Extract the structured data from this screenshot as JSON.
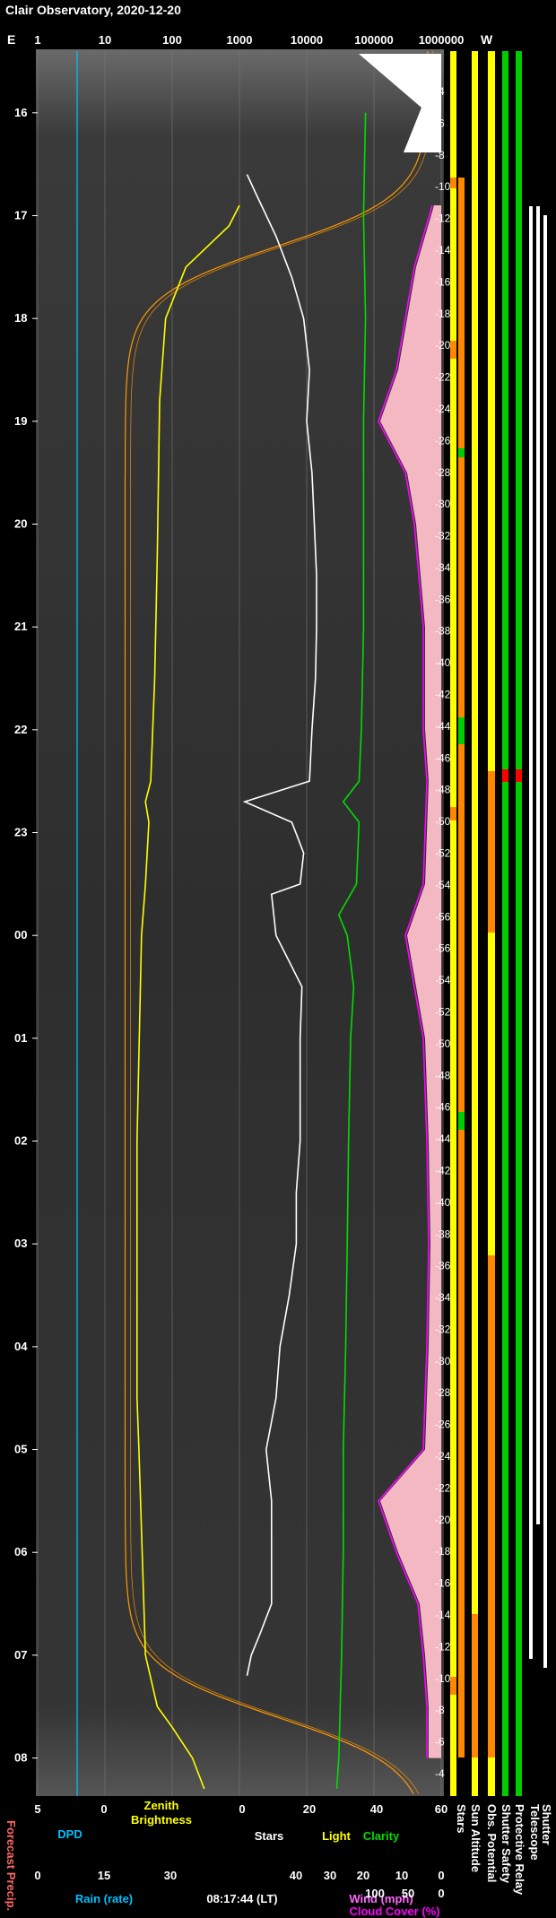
{
  "title": "Clair Observatory, 2020-12-20",
  "colors": {
    "background": "#000000",
    "zenith_brightness": "#ffff00",
    "stars": "#ffffff",
    "clarity": "#00dd00",
    "cloud_cover": "#ff00ff",
    "cloud_fill": "#ffc0cb",
    "dpd": "#00c0ff",
    "rain": "#00c0ff",
    "sun_track": "#ff9900",
    "status_green": "#00cc00",
    "status_yellow": "#ffff00",
    "status_orange": "#ff8800",
    "status_red": "#ff0000"
  },
  "chart_data": {
    "type": "line",
    "top_axis": {
      "left_label": "E",
      "right_label": "W",
      "ticks": [
        "1",
        "10",
        "100",
        "1000",
        "10000",
        "100000",
        "1000000"
      ],
      "scale": "log"
    },
    "time_axis": {
      "labels": [
        "16",
        "17",
        "18",
        "19",
        "20",
        "21",
        "22",
        "23",
        "00",
        "01",
        "02",
        "03",
        "04",
        "05",
        "06",
        "07",
        "08"
      ],
      "start_hour": 15.4,
      "end_hour": 32.37
    },
    "altitude_axis": {
      "labels": [
        "-4",
        "-6",
        "-8",
        "-10",
        "-12",
        "-14",
        "-16",
        "-18",
        "-20",
        "-22",
        "-24",
        "-26",
        "-28",
        "-30",
        "-32",
        "-34",
        "-36",
        "-38",
        "-40",
        "-42",
        "-44",
        "-46",
        "-48",
        "-50",
        "-52",
        "-54",
        "-56",
        "-56",
        "-54",
        "-52",
        "-50",
        "-48",
        "-46",
        "-44",
        "-42",
        "-40",
        "-38",
        "-36",
        "-34",
        "-32",
        "-30",
        "-28",
        "-26",
        "-24",
        "-22",
        "-20",
        "-18",
        "-16",
        "-14",
        "-12",
        "-10",
        "-8",
        "-6",
        "-4"
      ],
      "values": [
        -4,
        -6,
        -8,
        -10,
        -12,
        -14,
        -16,
        -18,
        -20,
        -22,
        -24,
        -26,
        -28,
        -30,
        -32,
        -34,
        -36,
        -38,
        -40,
        -42,
        -44,
        -46,
        -48,
        -50,
        -52,
        -54,
        -56,
        -56,
        -54,
        -52,
        -50,
        -48,
        -46,
        -44,
        -42,
        -40,
        -38,
        -36,
        -34,
        -32,
        -30,
        -28,
        -26,
        -24,
        -22,
        -20,
        -18,
        -16,
        -14,
        -12,
        -10,
        -8,
        -6,
        -4
      ]
    },
    "series": [
      {
        "name": "Zenith Brightness",
        "points": [
          [
            16.9,
            1000
          ],
          [
            17.1,
            700
          ],
          [
            17.5,
            160
          ],
          [
            18.0,
            80
          ],
          [
            18.8,
            65
          ],
          [
            20.3,
            60
          ],
          [
            21.5,
            55
          ],
          [
            22.5,
            48
          ],
          [
            22.7,
            40
          ],
          [
            22.9,
            45
          ],
          [
            23.5,
            40
          ],
          [
            24.0,
            35
          ],
          [
            26.0,
            30
          ],
          [
            28.5,
            30
          ],
          [
            29.0,
            32
          ],
          [
            31.0,
            40
          ],
          [
            31.5,
            60
          ],
          [
            31.7,
            100
          ],
          [
            32.0,
            200
          ],
          [
            32.3,
            300
          ]
        ]
      },
      {
        "name": "Stars",
        "points": [
          [
            16.6,
            1300
          ],
          [
            16.8,
            1800
          ],
          [
            17.2,
            3500
          ],
          [
            17.6,
            6000
          ],
          [
            18.0,
            9000
          ],
          [
            18.5,
            11000
          ],
          [
            19.0,
            10000
          ],
          [
            19.5,
            12000
          ],
          [
            20.0,
            13000
          ],
          [
            20.5,
            14000
          ],
          [
            21.0,
            14000
          ],
          [
            21.5,
            13500
          ],
          [
            22.0,
            12000
          ],
          [
            22.5,
            11000
          ],
          [
            22.7,
            1200
          ],
          [
            22.9,
            6000
          ],
          [
            23.2,
            9000
          ],
          [
            23.5,
            8000
          ],
          [
            23.6,
            3000
          ],
          [
            24.0,
            3500
          ],
          [
            24.2,
            5000
          ],
          [
            24.5,
            8500
          ],
          [
            25.0,
            8000
          ],
          [
            25.5,
            8000
          ],
          [
            26.0,
            8000
          ],
          [
            26.5,
            7000
          ],
          [
            27.0,
            7000
          ],
          [
            27.5,
            5500
          ],
          [
            28.0,
            4000
          ],
          [
            28.5,
            3500
          ],
          [
            29.0,
            2500
          ],
          [
            29.5,
            3000
          ],
          [
            30.0,
            3000
          ],
          [
            30.5,
            3000
          ],
          [
            30.8,
            2000
          ],
          [
            31.0,
            1500
          ],
          [
            31.2,
            1300
          ]
        ]
      },
      {
        "name": "Clarity",
        "points": [
          [
            16.0,
            75000
          ],
          [
            17.0,
            70000
          ],
          [
            18.0,
            75000
          ],
          [
            19.0,
            70000
          ],
          [
            20.0,
            70000
          ],
          [
            21.0,
            70000
          ],
          [
            22.0,
            65000
          ],
          [
            22.5,
            60000
          ],
          [
            22.7,
            35000
          ],
          [
            22.9,
            60000
          ],
          [
            23.5,
            55000
          ],
          [
            23.8,
            30000
          ],
          [
            24.0,
            40000
          ],
          [
            24.5,
            50000
          ],
          [
            25.0,
            45000
          ],
          [
            26.0,
            42000
          ],
          [
            27.0,
            40000
          ],
          [
            28.0,
            38000
          ],
          [
            29.0,
            35000
          ],
          [
            30.0,
            35000
          ],
          [
            31.0,
            33000
          ],
          [
            32.0,
            30000
          ],
          [
            32.3,
            28000
          ]
        ]
      },
      {
        "name": "Cloud Cover",
        "points": [
          [
            16.9,
            0
          ],
          [
            17.5,
            10
          ],
          [
            18.0,
            15
          ],
          [
            18.5,
            20
          ],
          [
            19.0,
            30
          ],
          [
            19.5,
            15
          ],
          [
            20.0,
            10
          ],
          [
            21.0,
            5
          ],
          [
            22.0,
            5
          ],
          [
            22.5,
            3
          ],
          [
            23.5,
            5
          ],
          [
            24.0,
            15
          ],
          [
            24.5,
            10
          ],
          [
            25.0,
            5
          ],
          [
            26.0,
            3
          ],
          [
            27.0,
            2
          ],
          [
            28.0,
            3
          ],
          [
            29.0,
            5
          ],
          [
            29.5,
            30
          ],
          [
            30.0,
            20
          ],
          [
            30.5,
            8
          ],
          [
            31.0,
            5
          ],
          [
            31.5,
            3
          ],
          [
            32.0,
            3
          ]
        ]
      }
    ],
    "bottom_axes": [
      {
        "name": "DPD",
        "ticks": [
          "5",
          "0"
        ]
      },
      {
        "name": "Zenith Brightness",
        "ticks": [
          "0",
          "20",
          "40",
          "60"
        ]
      },
      {
        "name": "Stars",
        "ticks": []
      },
      {
        "name": "Light",
        "ticks": []
      },
      {
        "name": "Clarity",
        "ticks": []
      },
      {
        "name": "Rain (rate)",
        "ticks": [
          "0",
          "15",
          "30"
        ]
      },
      {
        "name": "Wind (mph)",
        "ticks": [
          "40",
          "30",
          "20",
          "10",
          "0"
        ]
      },
      {
        "name": "Cloud Cover (%)",
        "ticks": [
          "100",
          "50",
          "0"
        ]
      }
    ]
  },
  "bottom": {
    "forecast_precip": "Forecast Precip.",
    "dpd_label": "DPD",
    "zenith_label_1": "Zenith",
    "zenith_label_2": "Brightness",
    "stars_label": "Stars",
    "light_label": "Light",
    "clarity_label": "Clarity",
    "rain_label": "Rain (rate)",
    "time_label": "08:17:44 (LT)",
    "wind_label": "Wind (mph)",
    "cloud_label": "Cloud Cover (%)",
    "status_labels": [
      "Stars",
      "Sun Altitude",
      "Obs. Potential",
      "Shutter Safety",
      "Protective Relay",
      "Telescope",
      "Shutter"
    ]
  }
}
